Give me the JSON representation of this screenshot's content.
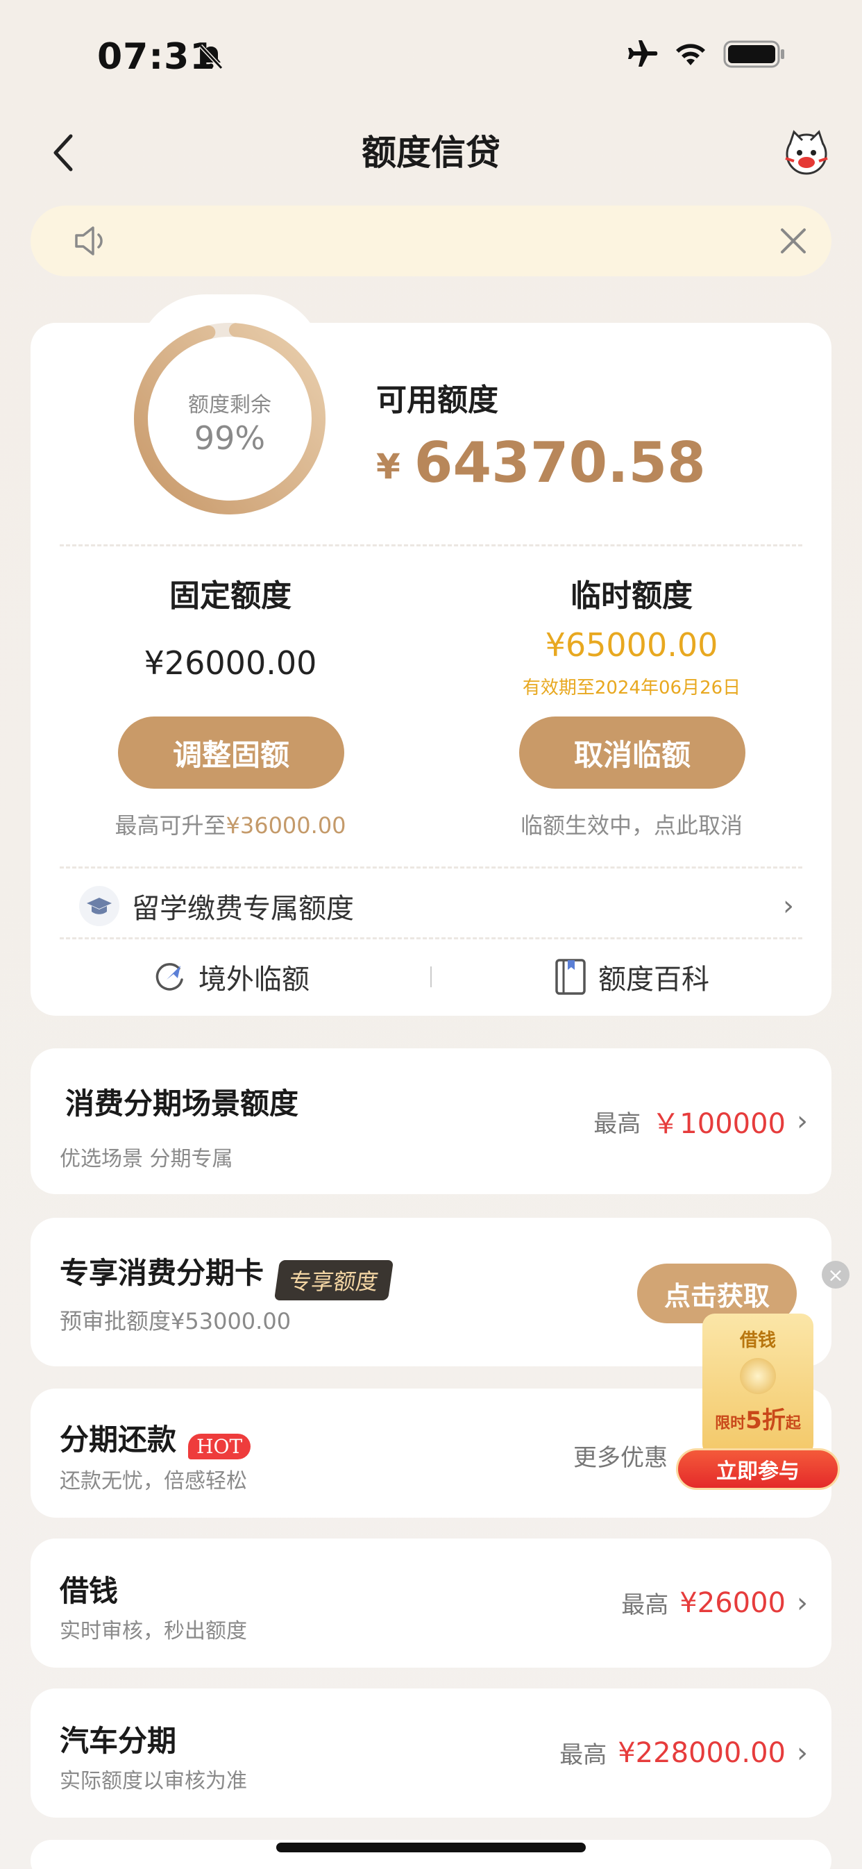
{
  "status_bar": {
    "time": "07:31"
  },
  "nav": {
    "title": "额度信贷"
  },
  "credit": {
    "ring_label": "额度剩余",
    "ring_percent": "99%",
    "remaining_fraction": 0.99,
    "available_title": "可用额度",
    "currency": "¥",
    "available_amount": "64370.58",
    "fixed": {
      "title": "固定额度",
      "amount": "¥26000.00",
      "button": "调整固额",
      "note_prefix": "最高可升至",
      "note_amount": "¥36000.00"
    },
    "temporary": {
      "title": "临时额度",
      "amount": "¥65000.00",
      "valid_until": "有效期至2024年06月26日",
      "button": "取消临额",
      "note": "临额生效中，点此取消"
    },
    "study_abroad": "留学缴费专属额度",
    "links": [
      "境外临额",
      "额度百科"
    ]
  },
  "list": {
    "installment_scene": {
      "title": "消费分期场景额度",
      "sub": "优选场景 分期专属",
      "label": "最高",
      "amount": "￥100000"
    },
    "exclusive_card": {
      "title": "专享消费分期卡",
      "tag": "专享额度",
      "sub": "预审批额度¥53000.00",
      "button": "点击获取"
    },
    "repayment": {
      "title": "分期还款",
      "badge": "HOT",
      "sub": "还款无忧，倍感轻松",
      "right": "更多优惠"
    },
    "borrow": {
      "title": "借钱",
      "sub": "实时审核，秒出额度",
      "label": "最高",
      "amount": "¥26000"
    },
    "car": {
      "title": "汽车分期",
      "sub": "实际额度以审核为准",
      "label": "最高",
      "amount": "¥228000.00"
    }
  },
  "promo": {
    "top": "借钱",
    "middle_prefix": "限时",
    "middle_big": "5折",
    "middle_suffix": "起",
    "button": "立即参与"
  },
  "colors": {
    "gold": "#c99a68",
    "amount_gold": "#b8875a",
    "yellow": "#e8a820",
    "red": "#e63c3c"
  }
}
